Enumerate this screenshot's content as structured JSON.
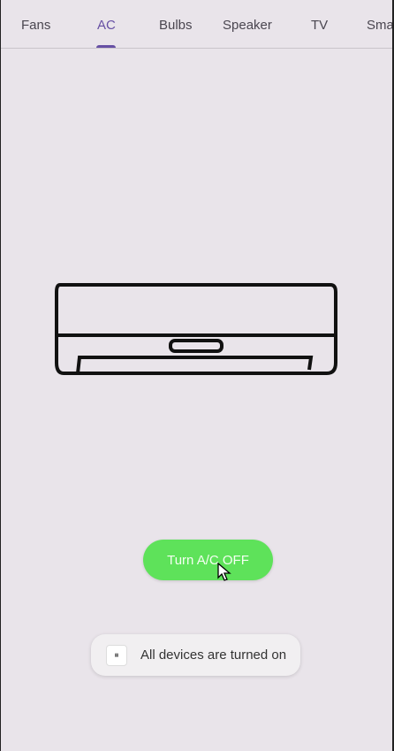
{
  "tabs": [
    {
      "label": "Fans"
    },
    {
      "label": "AC"
    },
    {
      "label": "Bulbs"
    },
    {
      "label": "Speaker"
    },
    {
      "label": "TV"
    },
    {
      "label": "Sma"
    }
  ],
  "active_tab": "AC",
  "button": {
    "label": "Turn A/C OFF",
    "color": "#5ee25a"
  },
  "toast": {
    "message": "All devices are turned on",
    "icon": "app-logo-icon"
  },
  "colors": {
    "accent": "#6750a4",
    "background": "#e9e4ea"
  }
}
